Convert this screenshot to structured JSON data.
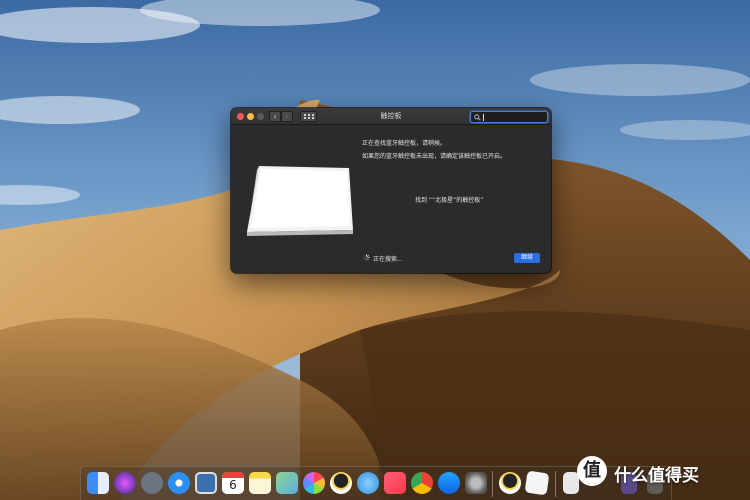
{
  "window": {
    "title": "触控板",
    "search_placeholder": "",
    "message_line1": "正在查找蓝牙触控板，请稍候。",
    "message_line2": "如果您的蓝牙触控板未出现，请确定该触控板已开启。",
    "found_text": "找到 “”北极星”的触控板”",
    "status_text": "正在搜索...",
    "continue_label": "继续"
  },
  "dock": {
    "calendar_day": "6",
    "apps": [
      "finder-icon",
      "siri-icon",
      "launchpad-icon",
      "safari-icon",
      "preview-icon",
      "calendar-icon",
      "notes-icon",
      "maps-icon",
      "photos-icon",
      "qq-icon",
      "messages-icon",
      "music-icon",
      "chrome-icon",
      "app-store-icon",
      "system-preferences-icon",
      "qq-icon",
      "textedit-icon",
      "finder-docs-icon",
      "downloads-icon",
      "trash-icon"
    ]
  },
  "watermark": {
    "badge": "值",
    "text": "什么值得买"
  },
  "colors": {
    "accent": "#2a6fe0",
    "window_bg": "#2b2b2d",
    "close": "#fc5753",
    "minimize": "#fdbc40"
  }
}
